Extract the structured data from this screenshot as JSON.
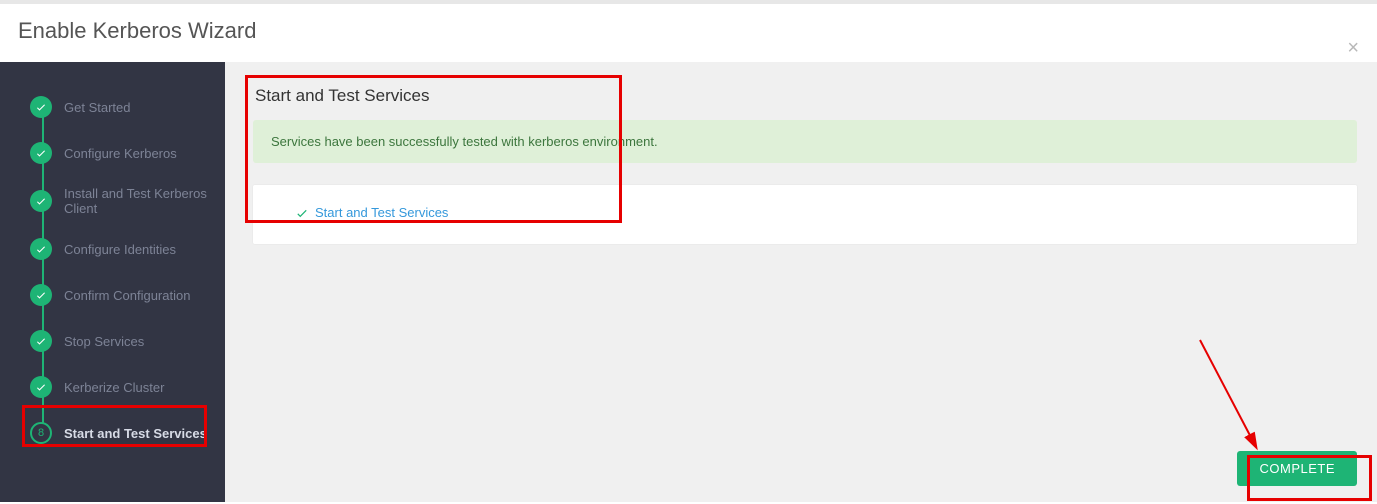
{
  "header": {
    "title": "Enable Kerberos Wizard"
  },
  "sidebar": {
    "steps": [
      {
        "label": "Get Started",
        "done": true
      },
      {
        "label": "Configure Kerberos",
        "done": true
      },
      {
        "label": "Install and Test Kerberos Client",
        "done": true
      },
      {
        "label": "Configure Identities",
        "done": true
      },
      {
        "label": "Confirm Configuration",
        "done": true
      },
      {
        "label": "Stop Services",
        "done": true
      },
      {
        "label": "Kerberize Cluster",
        "done": true
      },
      {
        "label": "Start and Test Services",
        "done": false,
        "number": "8",
        "active": true
      }
    ]
  },
  "main": {
    "panel_title": "Start and Test Services",
    "alert_text": "Services have been successfully tested with kerberos environment.",
    "task_link": "Start and Test Services"
  },
  "footer": {
    "complete_label": "COMPLETE"
  },
  "colors": {
    "accent": "#1eb475",
    "link": "#3498db",
    "success_bg": "#dff0d8",
    "success_fg": "#3c763d"
  }
}
